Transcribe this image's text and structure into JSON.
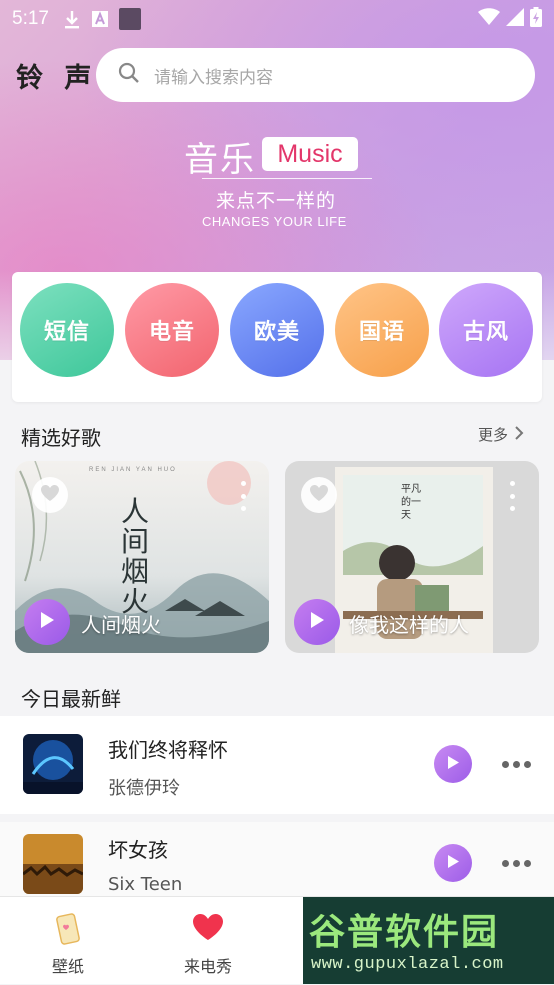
{
  "status_bar": {
    "time": "5:17",
    "icons": [
      "download-icon",
      "a-icon",
      "square-icon",
      "wifi-icon",
      "signal-icon",
      "battery-icon"
    ]
  },
  "header": {
    "brand": "铃 声",
    "search_placeholder": "请输入搜索内容"
  },
  "banner": {
    "title_zh": "音乐",
    "badge": "Music",
    "subtitle": "来点不一样的",
    "tagline": "CHANGES YOUR LIFE"
  },
  "categories": [
    {
      "label": "短信",
      "color_from": "#7de0bf",
      "color_to": "#3ec79a"
    },
    {
      "label": "电音",
      "color_from": "#ff9aa6",
      "color_to": "#f2646e"
    },
    {
      "label": "欧美",
      "color_from": "#8aa8ff",
      "color_to": "#5470ea"
    },
    {
      "label": "国语",
      "color_from": "#ffc487",
      "color_to": "#f7a04a"
    },
    {
      "label": "古风",
      "color_from": "#cfa8fb",
      "color_to": "#a674f3"
    }
  ],
  "featured": {
    "title": "精选好歌",
    "more": "更多",
    "cards": [
      {
        "title": "人间烟火",
        "art_text_top": "REN JIAN YAN HUO",
        "art_text_big": "人间烟火"
      },
      {
        "title": "像我这样的人",
        "art_text": "平凡的一天"
      }
    ]
  },
  "fresh": {
    "title": "今日最新鲜",
    "items": [
      {
        "title": "我们终将释怀",
        "artist": "张德伊玲"
      },
      {
        "title": "坏女孩",
        "artist": "Six Teen"
      }
    ]
  },
  "bottom_nav": {
    "items": [
      {
        "label": "壁纸",
        "icon": "wallpaper-icon"
      },
      {
        "label": "来电秀",
        "icon": "heart-icon"
      }
    ]
  },
  "watermark": {
    "text": "谷普软件园",
    "url": "www.gupuxlazal.com"
  },
  "colors": {
    "accent_purple": "#a766ee",
    "badge_red": "#e3366a"
  }
}
